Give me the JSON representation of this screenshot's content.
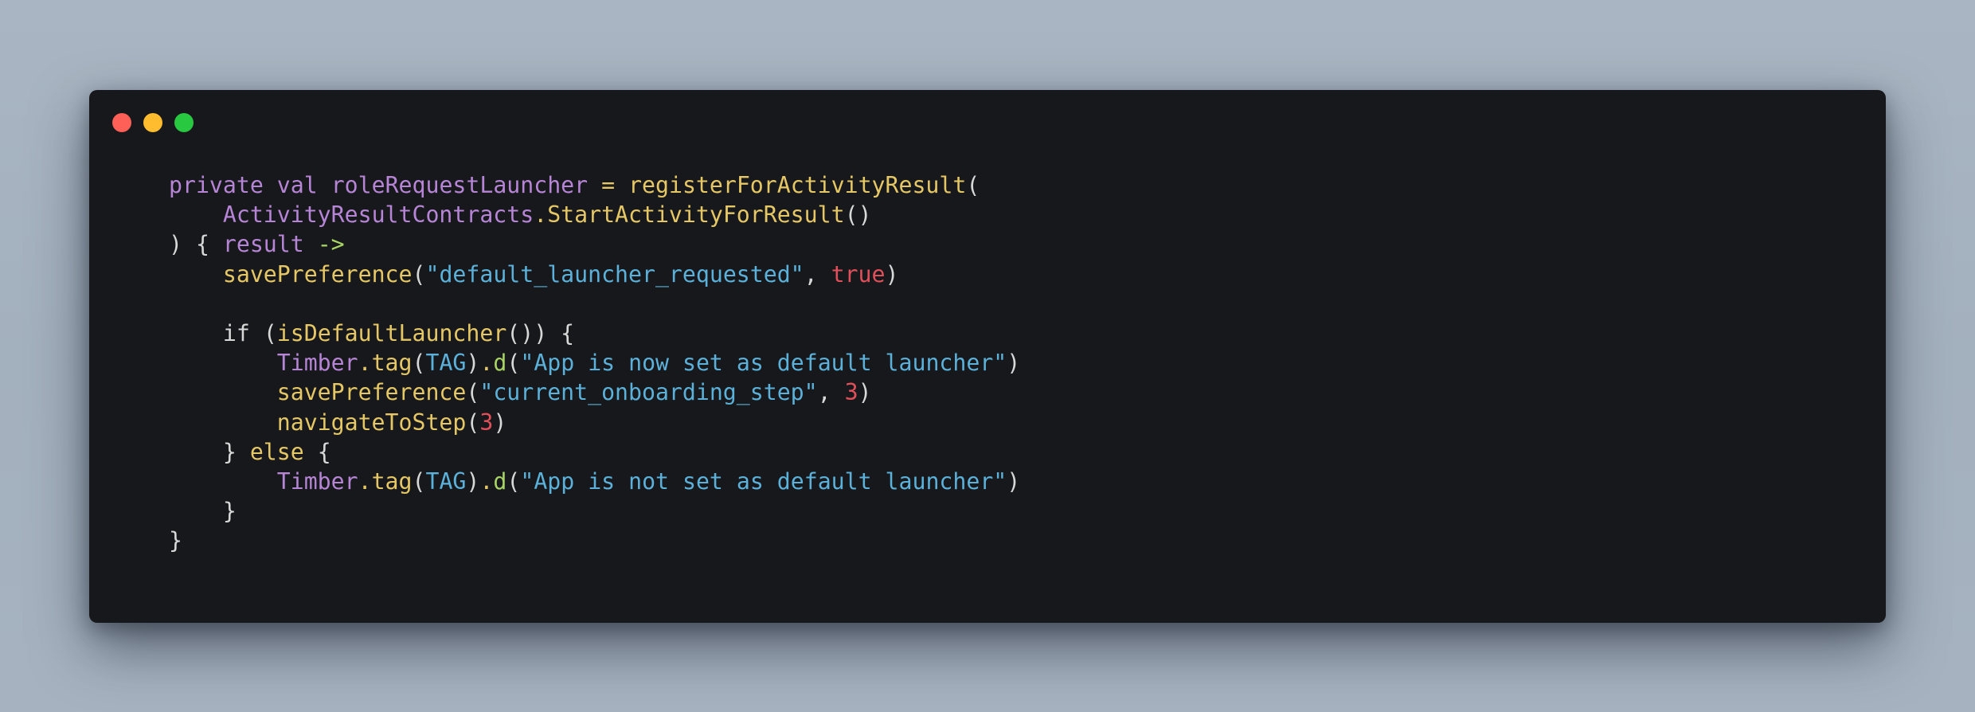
{
  "window": {
    "controls": [
      "close",
      "minimize",
      "zoom"
    ]
  },
  "code": {
    "lines": [
      [
        {
          "t": "private",
          "c": "kw"
        },
        {
          "t": " ",
          "c": "plain"
        },
        {
          "t": "val",
          "c": "kw"
        },
        {
          "t": " ",
          "c": "plain"
        },
        {
          "t": "roleRequestLauncher",
          "c": "id"
        },
        {
          "t": " ",
          "c": "plain"
        },
        {
          "t": "=",
          "c": "fn"
        },
        {
          "t": " ",
          "c": "plain"
        },
        {
          "t": "registerForActivityResult",
          "c": "fn"
        },
        {
          "t": "(",
          "c": "pun"
        }
      ],
      [
        {
          "t": "    ",
          "c": "plain"
        },
        {
          "t": "ActivityResultContracts",
          "c": "cls"
        },
        {
          "t": ".",
          "c": "dotp"
        },
        {
          "t": "StartActivityForResult",
          "c": "fn"
        },
        {
          "t": "()",
          "c": "pun"
        }
      ],
      [
        {
          "t": ") { ",
          "c": "plain"
        },
        {
          "t": "result",
          "c": "id"
        },
        {
          "t": " ",
          "c": "plain"
        },
        {
          "t": "->",
          "c": "arrow"
        }
      ],
      [
        {
          "t": "    ",
          "c": "plain"
        },
        {
          "t": "savePreference",
          "c": "fn"
        },
        {
          "t": "(",
          "c": "pun"
        },
        {
          "t": "\"default_launcher_requested\"",
          "c": "str"
        },
        {
          "t": ", ",
          "c": "pun"
        },
        {
          "t": "true",
          "c": "bool"
        },
        {
          "t": ")",
          "c": "pun"
        }
      ],
      [],
      [
        {
          "t": "    ",
          "c": "plain"
        },
        {
          "t": "if",
          "c": "plain"
        },
        {
          "t": " (",
          "c": "pun"
        },
        {
          "t": "isDefaultLauncher",
          "c": "fn"
        },
        {
          "t": "()) {",
          "c": "pun"
        }
      ],
      [
        {
          "t": "        ",
          "c": "plain"
        },
        {
          "t": "Timber",
          "c": "cls"
        },
        {
          "t": ".",
          "c": "dotp"
        },
        {
          "t": "tag",
          "c": "fn"
        },
        {
          "t": "(",
          "c": "pun"
        },
        {
          "t": "TAG",
          "c": "const"
        },
        {
          "t": ")",
          "c": "pun"
        },
        {
          "t": ".",
          "c": "dotp"
        },
        {
          "t": "d",
          "c": "dfn"
        },
        {
          "t": "(",
          "c": "pun"
        },
        {
          "t": "\"App is now set as default launcher\"",
          "c": "str"
        },
        {
          "t": ")",
          "c": "pun"
        }
      ],
      [
        {
          "t": "        ",
          "c": "plain"
        },
        {
          "t": "savePreference",
          "c": "fn"
        },
        {
          "t": "(",
          "c": "pun"
        },
        {
          "t": "\"current_onboarding_step\"",
          "c": "str"
        },
        {
          "t": ", ",
          "c": "pun"
        },
        {
          "t": "3",
          "c": "num"
        },
        {
          "t": ")",
          "c": "pun"
        }
      ],
      [
        {
          "t": "        ",
          "c": "plain"
        },
        {
          "t": "navigateToStep",
          "c": "fn"
        },
        {
          "t": "(",
          "c": "pun"
        },
        {
          "t": "3",
          "c": "num"
        },
        {
          "t": ")",
          "c": "pun"
        }
      ],
      [
        {
          "t": "    } ",
          "c": "plain"
        },
        {
          "t": "else",
          "c": "else"
        },
        {
          "t": " {",
          "c": "plain"
        }
      ],
      [
        {
          "t": "        ",
          "c": "plain"
        },
        {
          "t": "Timber",
          "c": "cls"
        },
        {
          "t": ".",
          "c": "dotp"
        },
        {
          "t": "tag",
          "c": "fn"
        },
        {
          "t": "(",
          "c": "pun"
        },
        {
          "t": "TAG",
          "c": "const"
        },
        {
          "t": ")",
          "c": "pun"
        },
        {
          "t": ".",
          "c": "dotp"
        },
        {
          "t": "d",
          "c": "dfn"
        },
        {
          "t": "(",
          "c": "pun"
        },
        {
          "t": "\"App is not set as default launcher\"",
          "c": "str"
        },
        {
          "t": ")",
          "c": "pun"
        }
      ],
      [
        {
          "t": "    }",
          "c": "plain"
        }
      ],
      [
        {
          "t": "}",
          "c": "plain"
        }
      ]
    ]
  },
  "colors": {
    "background": "#a6b2c0",
    "window": "#17181b",
    "close": "#fe5f57",
    "minimize": "#febc2e",
    "zoom": "#28c840",
    "keyword": "#b685d6",
    "function": "#e6c766",
    "string": "#5bb1d9",
    "number": "#e0505a",
    "arrow": "#a9d466"
  }
}
